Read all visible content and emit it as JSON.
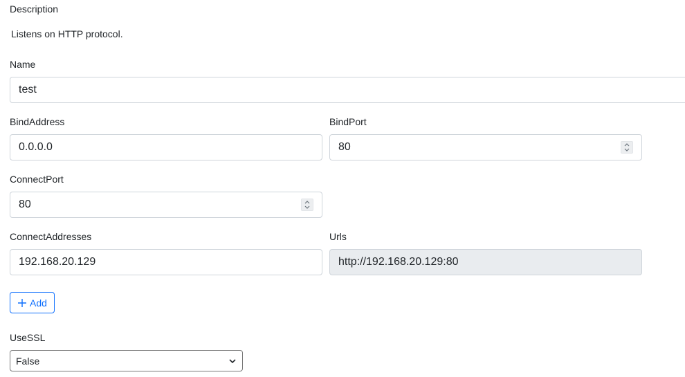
{
  "description": {
    "label": "Description",
    "text": "Listens on HTTP protocol."
  },
  "fields": {
    "name": {
      "label": "Name",
      "value": "test"
    },
    "bind_address": {
      "label": "BindAddress",
      "value": "0.0.0.0"
    },
    "bind_port": {
      "label": "BindPort",
      "value": "80"
    },
    "connect_port": {
      "label": "ConnectPort",
      "value": "80"
    },
    "connect_addresses": {
      "label": "ConnectAddresses",
      "value": "192.168.20.129"
    },
    "urls": {
      "label": "Urls",
      "value": "http://192.168.20.129:80"
    },
    "use_ssl": {
      "label": "UseSSL",
      "value": "False"
    }
  },
  "add_button": {
    "label": "Add",
    "icon": "plus-icon"
  },
  "colors": {
    "accent": "#0d6efd",
    "readonly_bg": "#e9ecef",
    "border": "#ced4da"
  }
}
